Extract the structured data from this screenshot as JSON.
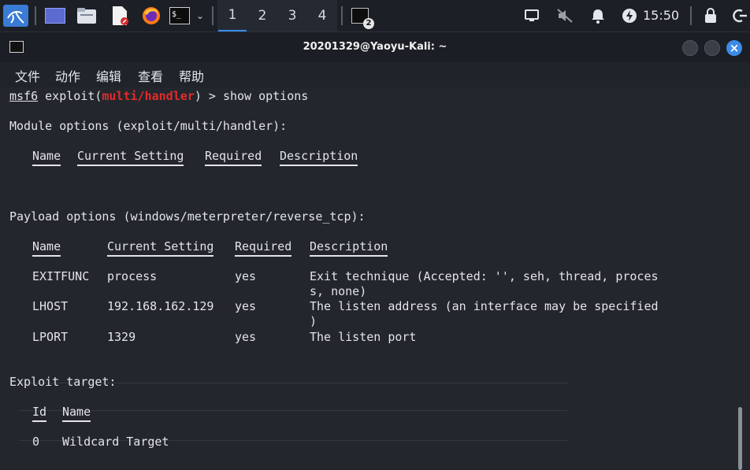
{
  "panel": {
    "workspaces": [
      "1",
      "2",
      "3",
      "4"
    ],
    "active_workspace": "1",
    "notification_count": "2",
    "clock": "15:50"
  },
  "window": {
    "title": "20201329@Yaoyu-Kali: ~",
    "menu": [
      "文件",
      "动作",
      "编辑",
      "查看",
      "帮助"
    ]
  },
  "terminal": {
    "prompt_prefix": "msf6",
    "prompt_mid_1": " exploit(",
    "prompt_module": "multi/handler",
    "prompt_mid_2": ") > ",
    "command": "show options",
    "module_header": "Module options (exploit/multi/handler):",
    "module_cols": [
      "Name",
      "Current Setting",
      "Required",
      "Description"
    ],
    "payload_header": "Payload options (windows/meterpreter/reverse_tcp):",
    "payload_cols": [
      "Name",
      "Current Setting",
      "Required",
      "Description"
    ],
    "rows": [
      {
        "name": "EXITFUNC",
        "setting": "process",
        "required": "yes",
        "desc": "Exit technique (Accepted: '', seh, thread, proces",
        "desc2": "s, none)"
      },
      {
        "name": "LHOST",
        "setting": "192.168.162.129",
        "required": "yes",
        "desc": "The listen address (an interface may be specified",
        "desc2": ")"
      },
      {
        "name": "LPORT",
        "setting": "1329",
        "required": "yes",
        "desc": "The listen port",
        "desc2": ""
      }
    ],
    "target_header": "Exploit target:",
    "target_cols": [
      "Id",
      "Name"
    ],
    "target_row": {
      "id": "0",
      "name": "Wildcard Target"
    }
  },
  "colors": {
    "accent": "#3d8be8",
    "prompt_red": "#e32b2b"
  }
}
